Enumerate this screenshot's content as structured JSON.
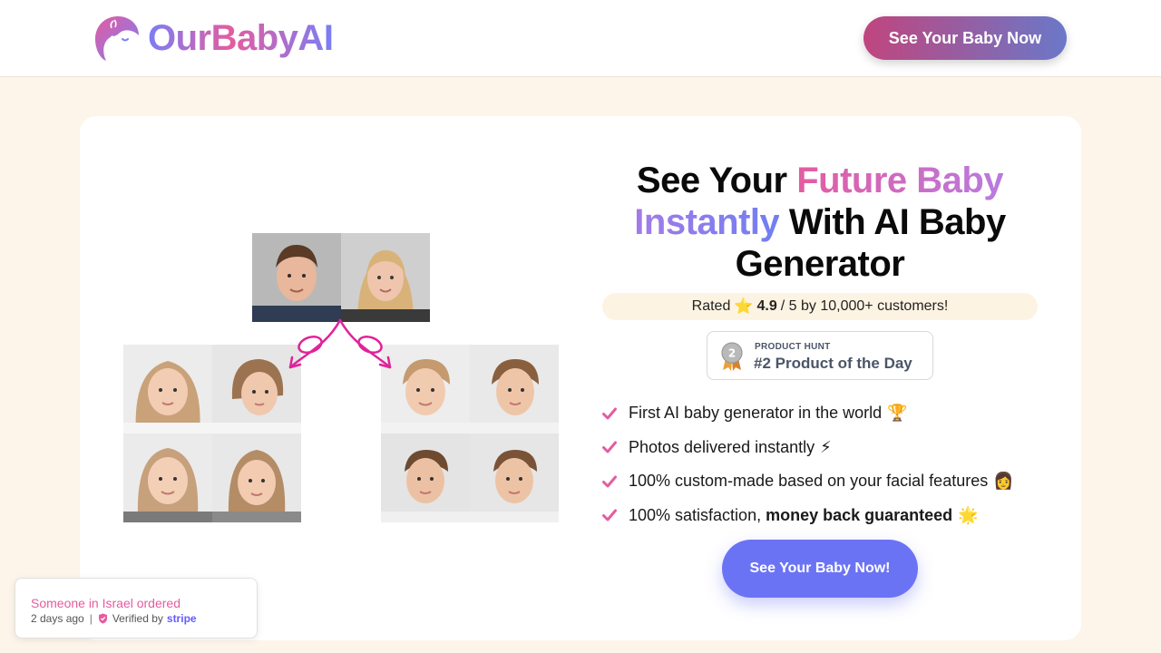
{
  "header": {
    "logo_text": "OurBabyAI",
    "cta_label": "See Your Baby Now"
  },
  "hero": {
    "headline": {
      "part1": "See Your ",
      "highlight1": "Future Baby",
      "highlight2": "Instantly",
      "part2": " With AI Baby Generator"
    },
    "rating": {
      "prefix": "Rated",
      "star_icon": "⭐",
      "score": "4.9",
      "suffix": "/ 5 by 10,000+ customers!"
    },
    "product_hunt": {
      "small_label": "PRODUCT HUNT",
      "title": "#2 Product of the Day",
      "medal_number": "2"
    },
    "features": [
      {
        "text": "First AI baby generator in the world",
        "bold": "",
        "emoji": "🏆"
      },
      {
        "text": "Photos delivered instantly",
        "bold": "",
        "emoji": "⚡"
      },
      {
        "text": "100% custom-made based on your facial features",
        "bold": "",
        "emoji": "👩"
      },
      {
        "text": "100% satisfaction, ",
        "bold": "money back guaranteed",
        "emoji": "🌟"
      }
    ],
    "cta_label": "See Your Baby Now!",
    "colors": {
      "accent": "#6b73f5",
      "pink": "#e45ca0",
      "check": "#e45ca0"
    }
  },
  "toast": {
    "title": "Someone in Israel ordered",
    "time": "2 days ago",
    "verified_label": "Verified by",
    "verified_brand": "stripe"
  }
}
